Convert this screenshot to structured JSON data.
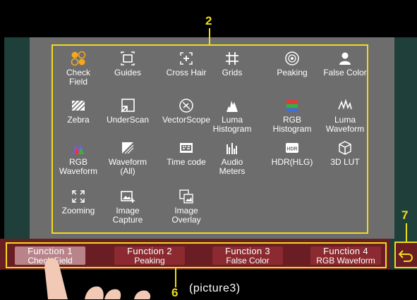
{
  "callouts": {
    "menu": "2",
    "function_bar": "6",
    "back": "7"
  },
  "menu_items": [
    {
      "label": "Check\nField",
      "icon": "check-field-icon"
    },
    {
      "label": "Guides",
      "icon": "guides-icon"
    },
    {
      "label": "Cross Hair",
      "icon": "cross-hair-icon"
    },
    {
      "label": "Grids",
      "icon": "grids-icon"
    },
    {
      "label": "Peaking",
      "icon": "peaking-icon"
    },
    {
      "label": "False Color",
      "icon": "false-color-icon"
    },
    {
      "label": "Zebra",
      "icon": "zebra-icon"
    },
    {
      "label": "UnderScan",
      "icon": "underscan-icon"
    },
    {
      "label": "VectorScope",
      "icon": "vectorscope-icon"
    },
    {
      "label": "Luma\nHistogram",
      "icon": "luma-histogram-icon"
    },
    {
      "label": "RGB\nHistogram",
      "icon": "rgb-histogram-icon"
    },
    {
      "label": "Luma\nWaveform",
      "icon": "luma-waveform-icon"
    },
    {
      "label": "RGB\nWaveform",
      "icon": "rgb-waveform-icon"
    },
    {
      "label": "Waveform\n(All)",
      "icon": "waveform-all-icon"
    },
    {
      "label": "Time code",
      "icon": "time-code-icon"
    },
    {
      "label": "Audio\nMeters",
      "icon": "audio-meters-icon"
    },
    {
      "label": "HDR(HLG)",
      "icon": "hdr-hlg-icon"
    },
    {
      "label": "3D LUT",
      "icon": "3d-lut-icon"
    },
    {
      "label": "Zooming",
      "icon": "zooming-icon"
    },
    {
      "label": "Image\nCapture",
      "icon": "image-capture-icon"
    },
    {
      "label": "Image\nOverlay",
      "icon": "image-overlay-icon"
    }
  ],
  "functions": [
    {
      "title": "Function 1",
      "value": "Check Field",
      "active": true
    },
    {
      "title": "Function 2",
      "value": "Peaking",
      "active": false
    },
    {
      "title": "Function 3",
      "value": "False Color",
      "active": false
    },
    {
      "title": "Function 4",
      "value": "RGB Waveform",
      "active": false
    }
  ],
  "caption": "(picture3)",
  "colors": {
    "highlight": "#f0dc1c",
    "function_bar": "#6a1d22",
    "panel": "#6d6d6d",
    "screen": "#1f3f3a"
  }
}
